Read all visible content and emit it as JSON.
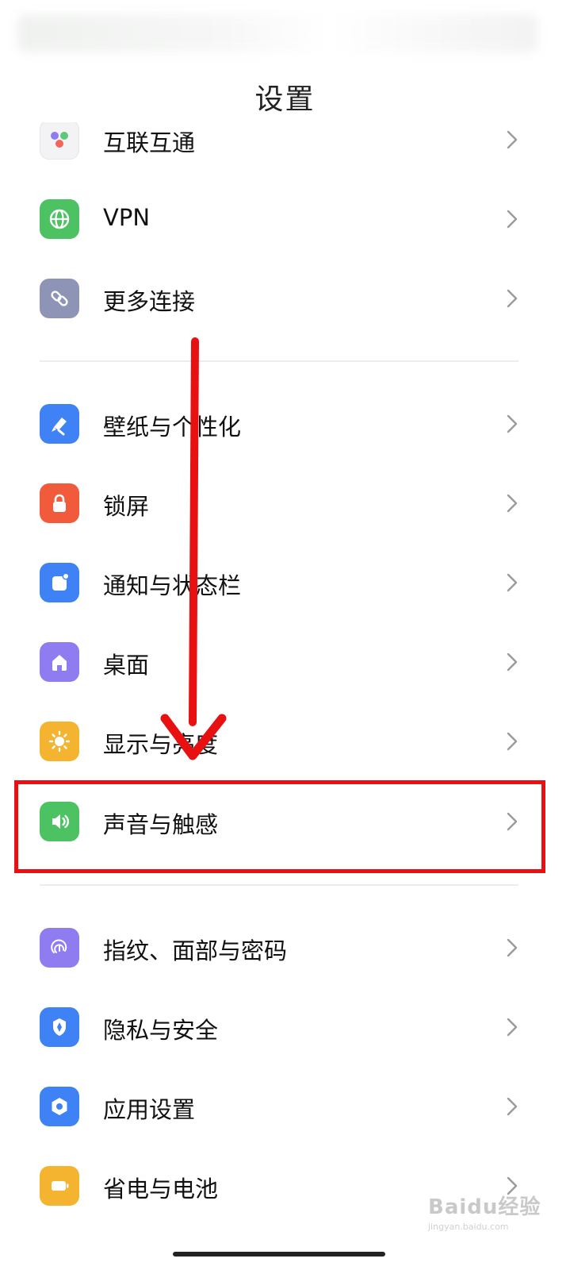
{
  "header": {
    "title": "设置"
  },
  "items": [
    {
      "label": "互联互通",
      "icon": "interconnect-icon",
      "color": "#f3f3f5"
    },
    {
      "label": "VPN",
      "icon": "globe-icon",
      "color": "#4cc263"
    },
    {
      "label": "更多连接",
      "icon": "link-icon",
      "color": "#8e94b5"
    },
    {
      "label": "壁纸与个性化",
      "icon": "brush-icon",
      "color": "#3f82f5"
    },
    {
      "label": "锁屏",
      "icon": "lock-icon",
      "color": "#f25a3c"
    },
    {
      "label": "通知与状态栏",
      "icon": "notification-icon",
      "color": "#3f82f5"
    },
    {
      "label": "桌面",
      "icon": "home-icon",
      "color": "#8f7cf0"
    },
    {
      "label": "显示与亮度",
      "icon": "sun-icon",
      "color": "#f5b42f"
    },
    {
      "label": "声音与触感",
      "icon": "speaker-icon",
      "color": "#4cc263"
    },
    {
      "label": "指纹、面部与密码",
      "icon": "fingerprint-icon",
      "color": "#8f7cf0"
    },
    {
      "label": "隐私与安全",
      "icon": "shield-icon",
      "color": "#3f82f5"
    },
    {
      "label": "应用设置",
      "icon": "app-settings-icon",
      "color": "#3f82f5"
    },
    {
      "label": "省电与电池",
      "icon": "battery-icon",
      "color": "#f5b42f"
    }
  ],
  "annotations": {
    "highlight_color": "#e81010",
    "arrow_color": "#e81010"
  },
  "watermark": {
    "text": "Baidu经验",
    "sub": "jingyan.baidu.com"
  }
}
